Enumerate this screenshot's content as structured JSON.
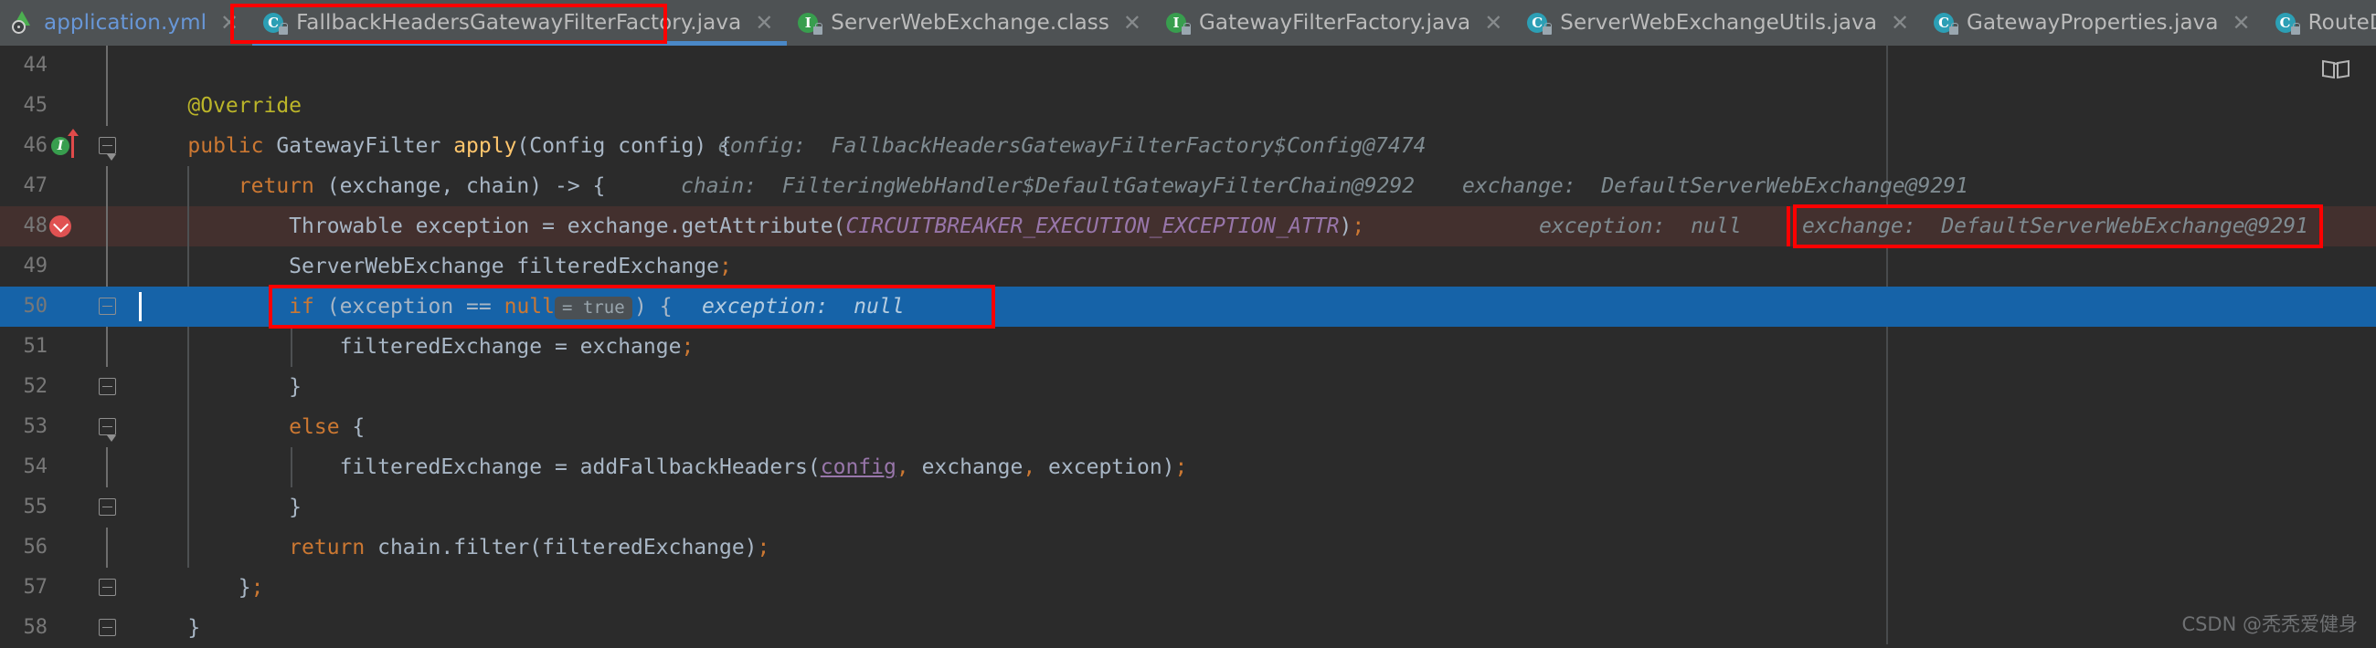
{
  "window": {
    "app": "IntelliJ IDEA Editor",
    "watermark": "CSDN @秃秃爱健身"
  },
  "tabs": [
    {
      "label": "application.yml",
      "icon": "yaml-file-icon",
      "state": "inactive",
      "close": "✕"
    },
    {
      "label": "FallbackHeadersGatewayFilterFactory.java",
      "icon": "java-class-icon",
      "state": "active",
      "close": "✕"
    },
    {
      "label": "ServerWebExchange.class",
      "icon": "java-interface-icon",
      "state": "inactive",
      "close": "✕"
    },
    {
      "label": "GatewayFilterFactory.java",
      "icon": "java-interface-icon",
      "state": "inactive",
      "close": "✕"
    },
    {
      "label": "ServerWebExchangeUtils.java",
      "icon": "java-class-icon",
      "state": "inactive",
      "close": "✕"
    },
    {
      "label": "GatewayProperties.java",
      "icon": "java-class-icon",
      "state": "inactive",
      "close": "✕"
    },
    {
      "label": "RouteDefinition.java",
      "icon": "java-class-icon",
      "state": "inactive",
      "close": "✕"
    },
    {
      "label": "",
      "icon": "java-class-icon",
      "state": "dim",
      "close": ""
    }
  ],
  "editor": {
    "reader_mode_icon": "book-icon",
    "lines": [
      {
        "num": "44",
        "text": ""
      },
      {
        "num": "45",
        "text": "    @Override"
      },
      {
        "num": "46",
        "text": "    public GatewayFilter apply(Config config) {",
        "hint": "config:  FallbackHeadersGatewayFilterFactory$Config@7474"
      },
      {
        "num": "47",
        "text": "        return (exchange, chain) -> {",
        "hint": "chain:  FilteringWebHandler$DefaultGatewayFilterChain@9292",
        "hint2": "exchange:  DefaultServerWebExchange@9291"
      },
      {
        "num": "48",
        "text": "            Throwable exception = exchange.getAttribute(CIRCUITBREAKER_EXECUTION_EXCEPTION_ATTR);",
        "hint": "exception:  null",
        "hint2": "exchange:  DefaultServerWebExchange@9291"
      },
      {
        "num": "49",
        "text": "            ServerWebExchange filteredExchange;"
      },
      {
        "num": "50",
        "text": "            if (exception == null = true ) {",
        "chip": "= true",
        "hint": "exception:  null"
      },
      {
        "num": "51",
        "text": "                filteredExchange = exchange;"
      },
      {
        "num": "52",
        "text": "            }"
      },
      {
        "num": "53",
        "text": "            else {"
      },
      {
        "num": "54",
        "text": "                filteredExchange = addFallbackHeaders(config, exchange, exception);"
      },
      {
        "num": "55",
        "text": "            }"
      },
      {
        "num": "56",
        "text": "            return chain.filter(filteredExchange);"
      },
      {
        "num": "57",
        "text": "        };"
      },
      {
        "num": "58",
        "text": "    }"
      }
    ],
    "gutter": {
      "line46_marker": "implementing-method-icon",
      "line46_marker_label": "I",
      "line48_marker": "breakpoint-verified-icon"
    },
    "annotations": [
      {
        "name": "tab-title-highlight",
        "target": "FallbackHeadersGatewayFilterFactory.java"
      },
      {
        "name": "exchange-hint-highlight",
        "target": "exchange: DefaultServerWebExchange@9291"
      },
      {
        "name": "if-condition-highlight",
        "target": "if (exception == null = true ) {  exception: null"
      }
    ],
    "colors": {
      "background": "#2b2b2b",
      "tabbar": "#3c3f41",
      "selection": "#1663a8",
      "error_line": "#43302e",
      "annotation": "#ff0000",
      "keyword": "#cc7832",
      "annotation_token": "#bbb529",
      "method": "#ffc66d",
      "constant": "#9876aa",
      "text": "#a9b7c6",
      "inlay_hint": "#7f8b91"
    }
  }
}
